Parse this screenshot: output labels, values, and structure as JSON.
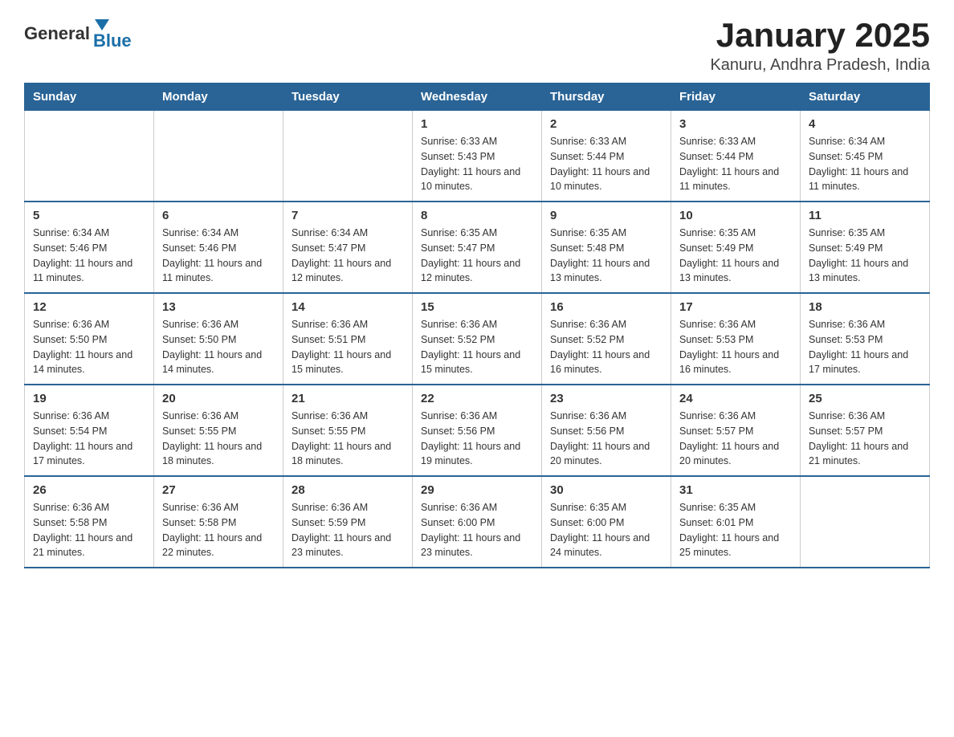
{
  "logo": {
    "general": "General",
    "blue": "Blue"
  },
  "header": {
    "month_year": "January 2025",
    "location": "Kanuru, Andhra Pradesh, India"
  },
  "weekdays": [
    "Sunday",
    "Monday",
    "Tuesday",
    "Wednesday",
    "Thursday",
    "Friday",
    "Saturday"
  ],
  "weeks": [
    [
      {
        "day": "",
        "info": ""
      },
      {
        "day": "",
        "info": ""
      },
      {
        "day": "",
        "info": ""
      },
      {
        "day": "1",
        "info": "Sunrise: 6:33 AM\nSunset: 5:43 PM\nDaylight: 11 hours and 10 minutes."
      },
      {
        "day": "2",
        "info": "Sunrise: 6:33 AM\nSunset: 5:44 PM\nDaylight: 11 hours and 10 minutes."
      },
      {
        "day": "3",
        "info": "Sunrise: 6:33 AM\nSunset: 5:44 PM\nDaylight: 11 hours and 11 minutes."
      },
      {
        "day": "4",
        "info": "Sunrise: 6:34 AM\nSunset: 5:45 PM\nDaylight: 11 hours and 11 minutes."
      }
    ],
    [
      {
        "day": "5",
        "info": "Sunrise: 6:34 AM\nSunset: 5:46 PM\nDaylight: 11 hours and 11 minutes."
      },
      {
        "day": "6",
        "info": "Sunrise: 6:34 AM\nSunset: 5:46 PM\nDaylight: 11 hours and 11 minutes."
      },
      {
        "day": "7",
        "info": "Sunrise: 6:34 AM\nSunset: 5:47 PM\nDaylight: 11 hours and 12 minutes."
      },
      {
        "day": "8",
        "info": "Sunrise: 6:35 AM\nSunset: 5:47 PM\nDaylight: 11 hours and 12 minutes."
      },
      {
        "day": "9",
        "info": "Sunrise: 6:35 AM\nSunset: 5:48 PM\nDaylight: 11 hours and 13 minutes."
      },
      {
        "day": "10",
        "info": "Sunrise: 6:35 AM\nSunset: 5:49 PM\nDaylight: 11 hours and 13 minutes."
      },
      {
        "day": "11",
        "info": "Sunrise: 6:35 AM\nSunset: 5:49 PM\nDaylight: 11 hours and 13 minutes."
      }
    ],
    [
      {
        "day": "12",
        "info": "Sunrise: 6:36 AM\nSunset: 5:50 PM\nDaylight: 11 hours and 14 minutes."
      },
      {
        "day": "13",
        "info": "Sunrise: 6:36 AM\nSunset: 5:50 PM\nDaylight: 11 hours and 14 minutes."
      },
      {
        "day": "14",
        "info": "Sunrise: 6:36 AM\nSunset: 5:51 PM\nDaylight: 11 hours and 15 minutes."
      },
      {
        "day": "15",
        "info": "Sunrise: 6:36 AM\nSunset: 5:52 PM\nDaylight: 11 hours and 15 minutes."
      },
      {
        "day": "16",
        "info": "Sunrise: 6:36 AM\nSunset: 5:52 PM\nDaylight: 11 hours and 16 minutes."
      },
      {
        "day": "17",
        "info": "Sunrise: 6:36 AM\nSunset: 5:53 PM\nDaylight: 11 hours and 16 minutes."
      },
      {
        "day": "18",
        "info": "Sunrise: 6:36 AM\nSunset: 5:53 PM\nDaylight: 11 hours and 17 minutes."
      }
    ],
    [
      {
        "day": "19",
        "info": "Sunrise: 6:36 AM\nSunset: 5:54 PM\nDaylight: 11 hours and 17 minutes."
      },
      {
        "day": "20",
        "info": "Sunrise: 6:36 AM\nSunset: 5:55 PM\nDaylight: 11 hours and 18 minutes."
      },
      {
        "day": "21",
        "info": "Sunrise: 6:36 AM\nSunset: 5:55 PM\nDaylight: 11 hours and 18 minutes."
      },
      {
        "day": "22",
        "info": "Sunrise: 6:36 AM\nSunset: 5:56 PM\nDaylight: 11 hours and 19 minutes."
      },
      {
        "day": "23",
        "info": "Sunrise: 6:36 AM\nSunset: 5:56 PM\nDaylight: 11 hours and 20 minutes."
      },
      {
        "day": "24",
        "info": "Sunrise: 6:36 AM\nSunset: 5:57 PM\nDaylight: 11 hours and 20 minutes."
      },
      {
        "day": "25",
        "info": "Sunrise: 6:36 AM\nSunset: 5:57 PM\nDaylight: 11 hours and 21 minutes."
      }
    ],
    [
      {
        "day": "26",
        "info": "Sunrise: 6:36 AM\nSunset: 5:58 PM\nDaylight: 11 hours and 21 minutes."
      },
      {
        "day": "27",
        "info": "Sunrise: 6:36 AM\nSunset: 5:58 PM\nDaylight: 11 hours and 22 minutes."
      },
      {
        "day": "28",
        "info": "Sunrise: 6:36 AM\nSunset: 5:59 PM\nDaylight: 11 hours and 23 minutes."
      },
      {
        "day": "29",
        "info": "Sunrise: 6:36 AM\nSunset: 6:00 PM\nDaylight: 11 hours and 23 minutes."
      },
      {
        "day": "30",
        "info": "Sunrise: 6:35 AM\nSunset: 6:00 PM\nDaylight: 11 hours and 24 minutes."
      },
      {
        "day": "31",
        "info": "Sunrise: 6:35 AM\nSunset: 6:01 PM\nDaylight: 11 hours and 25 minutes."
      },
      {
        "day": "",
        "info": ""
      }
    ]
  ]
}
